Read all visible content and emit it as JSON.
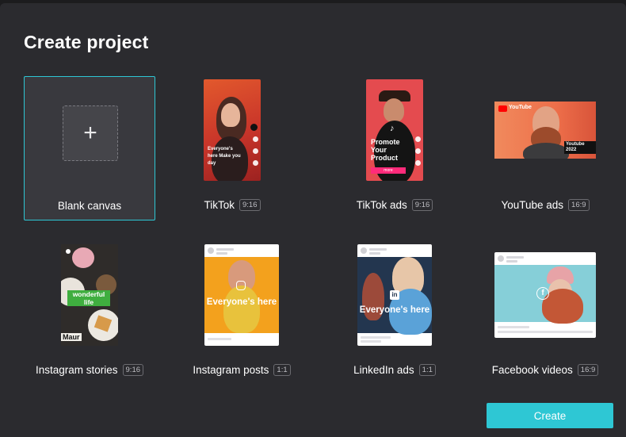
{
  "dialog": {
    "title": "Create project",
    "create_button": "Create"
  },
  "icons": {
    "blank_plus": "plus-icon",
    "tiktok": "tiktok-icon",
    "youtube": "youtube-icon",
    "instagram": "instagram-icon",
    "linkedin": "linkedin-icon",
    "facebook": "facebook-icon"
  },
  "colors": {
    "accent": "#2ec7d4",
    "background": "#2b2b2f",
    "tiktok_ads_bg": "#e44b4f",
    "tiktok_bg": "#d94b2c",
    "instagram_posts_bg": "#f3a11d"
  },
  "templates": [
    {
      "label": "Blank canvas",
      "ratio": ""
    },
    {
      "label": "TikTok",
      "ratio": "9:16",
      "thumb_text": "Everyone's here Make you day"
    },
    {
      "label": "TikTok ads",
      "ratio": "9:16",
      "thumb_text": "Promote Your Product",
      "thumb_button": "more"
    },
    {
      "label": "YouTube ads",
      "ratio": "16:9",
      "thumb_brand": "YouTube",
      "thumb_text": "Youtube 2022"
    },
    {
      "label": "Instagram stories",
      "ratio": "9:16",
      "thumb_text": "wonderful life",
      "thumb_sign": "Maur"
    },
    {
      "label": "Instagram posts",
      "ratio": "1:1",
      "thumb_text": "Everyone's here"
    },
    {
      "label": "LinkedIn ads",
      "ratio": "1:1",
      "thumb_text": "Everyone's here"
    },
    {
      "label": "Facebook videos",
      "ratio": "16:9"
    }
  ]
}
